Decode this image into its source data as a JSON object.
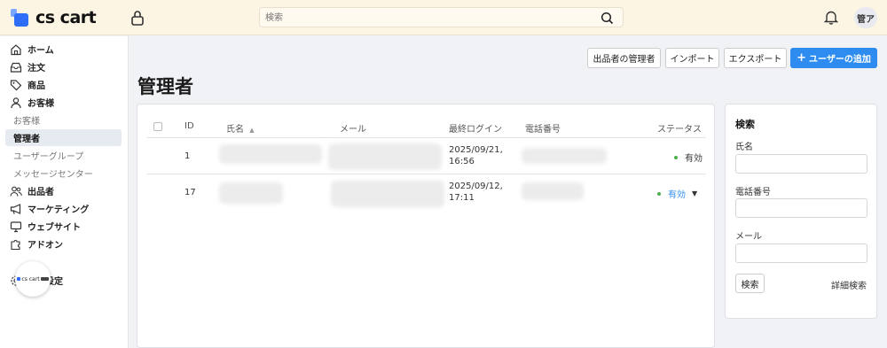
{
  "app": {
    "logo_text": "cs cart",
    "search_placeholder": "検索",
    "avatar_initials": "管ア"
  },
  "sidebar": {
    "items": [
      {
        "label": "ホーム",
        "icon": "home-icon"
      },
      {
        "label": "注文",
        "icon": "inbox-icon"
      },
      {
        "label": "商品",
        "icon": "tag-icon"
      },
      {
        "label": "お客様",
        "icon": "user-icon"
      },
      {
        "label": "お客様"
      },
      {
        "label": "管理者",
        "active": true
      },
      {
        "label": "ユーザーグループ"
      },
      {
        "label": "メッセージセンター"
      },
      {
        "label": "出品者",
        "icon": "users-icon"
      },
      {
        "label": "マーケティング",
        "icon": "megaphone-icon"
      },
      {
        "label": "ウェブサイト",
        "icon": "monitor-icon"
      },
      {
        "label": "アドオン",
        "icon": "puzzle-icon"
      },
      {
        "label": "基本設定",
        "icon": "gear-icon"
      }
    ],
    "badge_text": "cs cart"
  },
  "header": {
    "title": "管理者",
    "buttons": {
      "vendor_admins": "出品者の管理者",
      "import": "インポート",
      "export": "エクスポート",
      "add_user": "ユーザーの追加"
    }
  },
  "table": {
    "columns": {
      "id": "ID",
      "name": "氏名",
      "email": "メール",
      "last_login": "最終ログイン",
      "phone": "電話番号",
      "status": "ステータス"
    },
    "rows": [
      {
        "id": "1",
        "last_login_date": "2025/09/21,",
        "last_login_time": "16:56",
        "status": "有効"
      },
      {
        "id": "17",
        "last_login_date": "2025/09/12,",
        "last_login_time": "17:11",
        "status": "有効"
      }
    ]
  },
  "search_panel": {
    "title": "検索",
    "name_label": "氏名",
    "phone_label": "電話番号",
    "email_label": "メール",
    "search_button": "検索",
    "advanced_link": "詳細検索"
  },
  "colors": {
    "topbar_bg": "#fdf5e4",
    "accent": "#2e8cf0",
    "status_green": "#4caf50"
  }
}
